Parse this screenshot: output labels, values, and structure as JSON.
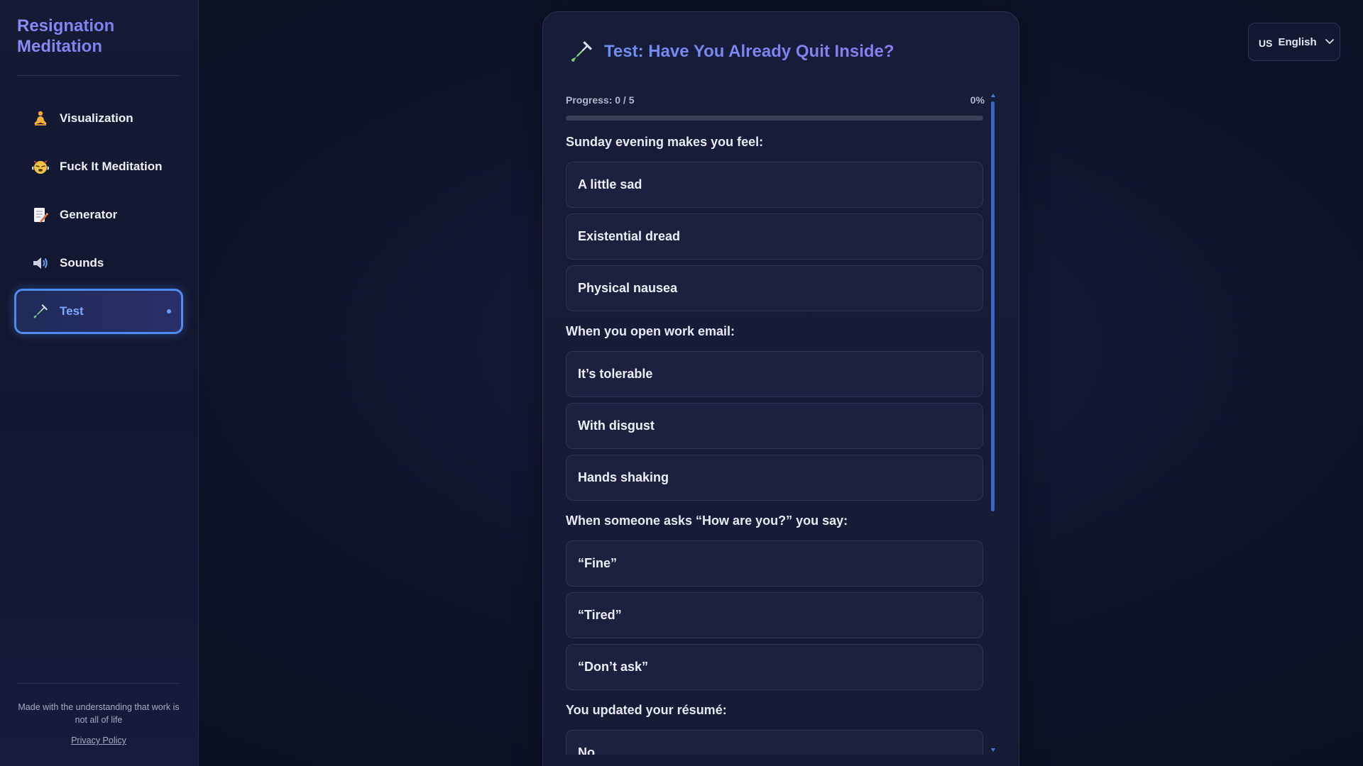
{
  "sidebar": {
    "brand": "Resignation Meditation",
    "items": [
      {
        "label": "Visualization",
        "icon": "meditation-person-icon"
      },
      {
        "label": "Fuck It Meditation",
        "icon": "steaming-face-icon"
      },
      {
        "label": "Generator",
        "icon": "memo-pencil-icon"
      },
      {
        "label": "Sounds",
        "icon": "speaker-icon"
      },
      {
        "label": "Test",
        "icon": "test-tube-icon",
        "active": true
      }
    ],
    "footer_text": "Made with the understanding that work is not all of life",
    "privacy_link": "Privacy Policy"
  },
  "language": {
    "code": "US",
    "label": "English"
  },
  "quiz": {
    "title": "Test: Have You Already Quit Inside?",
    "progress_label": "Progress: 0 / 5",
    "progress_percent": "0%",
    "progress_value": 0,
    "questions": [
      {
        "text": "Sunday evening makes you feel:",
        "options": [
          "A little sad",
          "Existential dread",
          "Physical nausea"
        ]
      },
      {
        "text": "When you open work email:",
        "options": [
          "It’s tolerable",
          "With disgust",
          "Hands shaking"
        ]
      },
      {
        "text": "When someone asks “How are you?” you say:",
        "options": [
          "“Fine”",
          "“Tired”",
          "“Don’t ask”"
        ]
      },
      {
        "text": "You updated your résumé:",
        "options": [
          "No"
        ]
      }
    ]
  },
  "colors": {
    "accent": "#4f8cf0",
    "title_gradient_start": "#6f8ef2",
    "title_gradient_end": "#8a7cf0",
    "background": "#10142c"
  }
}
